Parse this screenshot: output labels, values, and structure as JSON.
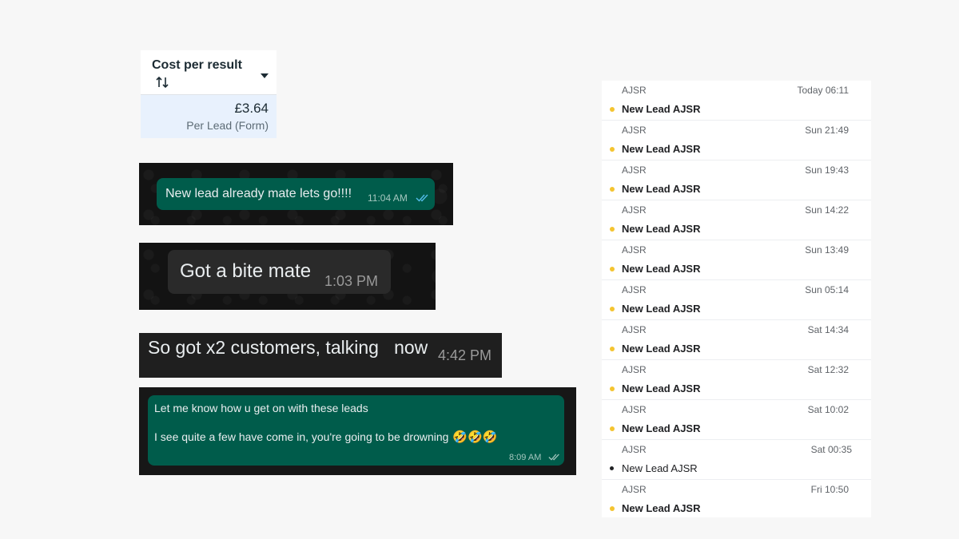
{
  "cost_card": {
    "title": "Cost per result",
    "value": "£3.64",
    "subtitle": "Per Lead (Form)"
  },
  "chats": [
    {
      "text": "New lead already mate lets go!!!!",
      "time": "11:04 AM",
      "read_ticks": "blue"
    },
    {
      "text": "Got a bite mate",
      "time": "1:03 PM"
    },
    {
      "text": "So got x2 customers, talking   now",
      "time": "4:42 PM"
    },
    {
      "line1": "Let me know how u get on with these leads",
      "line2": "I see quite a few have come in, you're going to be drowning",
      "emoji": "🤣🤣🤣",
      "time": "8:09 AM",
      "read_ticks": "grey"
    }
  ],
  "emails": [
    {
      "sender": "AJSR",
      "date": "Today 06:11",
      "subject": "New Lead AJSR",
      "unread": true
    },
    {
      "sender": "AJSR",
      "date": "Sun 21:49",
      "subject": "New Lead AJSR",
      "unread": true
    },
    {
      "sender": "AJSR",
      "date": "Sun 19:43",
      "subject": "New Lead AJSR",
      "unread": true
    },
    {
      "sender": "AJSR",
      "date": "Sun 14:22",
      "subject": "New Lead AJSR",
      "unread": true
    },
    {
      "sender": "AJSR",
      "date": "Sun 13:49",
      "subject": "New Lead AJSR",
      "unread": true
    },
    {
      "sender": "AJSR",
      "date": "Sun 05:14",
      "subject": "New Lead AJSR",
      "unread": true
    },
    {
      "sender": "AJSR",
      "date": "Sat 14:34",
      "subject": "New Lead AJSR",
      "unread": true
    },
    {
      "sender": "AJSR",
      "date": "Sat 12:32",
      "subject": "New Lead AJSR",
      "unread": true
    },
    {
      "sender": "AJSR",
      "date": "Sat 10:02",
      "subject": "New Lead AJSR",
      "unread": true
    },
    {
      "sender": "AJSR",
      "date": "Sat 00:35",
      "subject": "New Lead AJSR",
      "unread": false
    },
    {
      "sender": "AJSR",
      "date": "Fri 10:50",
      "subject": "New Lead AJSR",
      "unread": true
    }
  ],
  "colors": {
    "whatsapp_outgoing": "#005c4b",
    "unread_dot": "#f4c430",
    "cost_highlight": "#e8f1fd"
  }
}
